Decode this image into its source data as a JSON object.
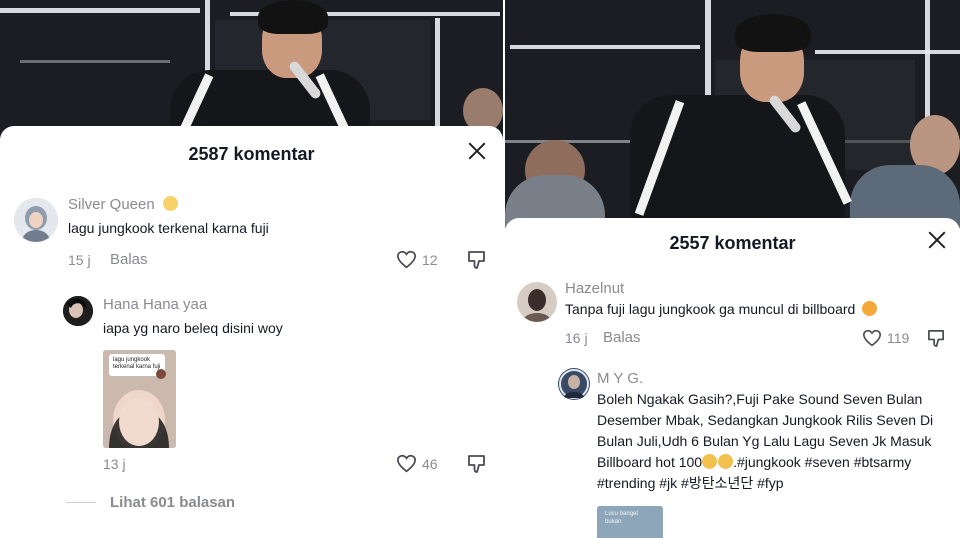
{
  "left": {
    "title": "2587 komentar",
    "comments": [
      {
        "user": "Silver Queen",
        "text": "lagu jungkook terkenal karna fuji",
        "time": "15 j",
        "reply": "Balas",
        "likes": "12"
      }
    ],
    "replies": [
      {
        "user": "Hana Hana yaa",
        "text": "iapa yg naro beleq disini woy",
        "sticker_text": [
          "lagu jungkook",
          "terkenal karna fuji"
        ],
        "time": "13 j",
        "likes": "46"
      }
    ],
    "view_more": "Lihat 601 balasan"
  },
  "right": {
    "title": "2557 komentar",
    "comments": [
      {
        "user": "Hazelnut",
        "text": "Tanpa fuji lagu jungkook ga muncul di billboard",
        "time": "16 j",
        "reply": "Balas",
        "likes": "119"
      }
    ],
    "replies": [
      {
        "user": "M Y G.",
        "lines": [
          "Boleh Ngakak Gasih?,Fuji Pake Sound Seven Bulan",
          "Desember Mbak, Sedangkan Jungkook Rilis Seven Di",
          "Bulan Juli,Udh 6 Bulan Yg Lalu Lagu Seven Jk Masuk",
          "Billboard hot 100",
          ".#jungkook #seven #btsarmy",
          "#trending #jk #방탄소년단 #fyp"
        ],
        "sticker_text": [
          "Lucu banget",
          "bukan"
        ]
      }
    ]
  },
  "colors": {
    "text": "#161823",
    "muted": "#8a8b91",
    "sheet": "#ffffff"
  },
  "icons": [
    "close-icon",
    "heart-outline-icon",
    "dislike-icon",
    "emoji-icon"
  ]
}
